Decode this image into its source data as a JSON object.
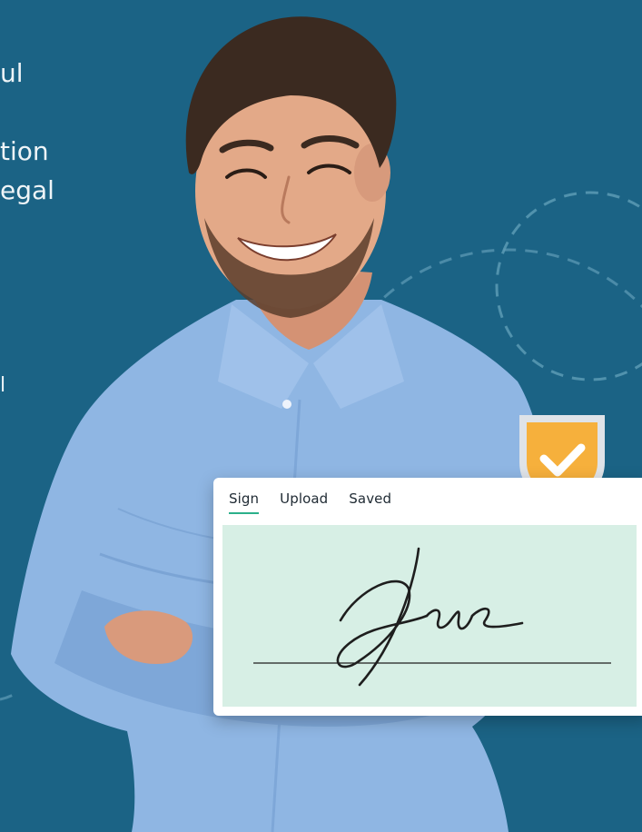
{
  "background_text": {
    "line1": "ul",
    "line2": "tion",
    "line3": "egal",
    "line4": "l"
  },
  "signature_widget": {
    "tabs": [
      {
        "label": "Sign",
        "active": true
      },
      {
        "label": "Upload",
        "active": false
      },
      {
        "label": "Saved",
        "active": false
      }
    ]
  },
  "colors": {
    "background": "#1b6385",
    "shield": "#f6b03c",
    "accent": "#2bb08a",
    "signature_pad": "#d7efe5"
  },
  "icons": {
    "shield": "shield-check-icon"
  }
}
